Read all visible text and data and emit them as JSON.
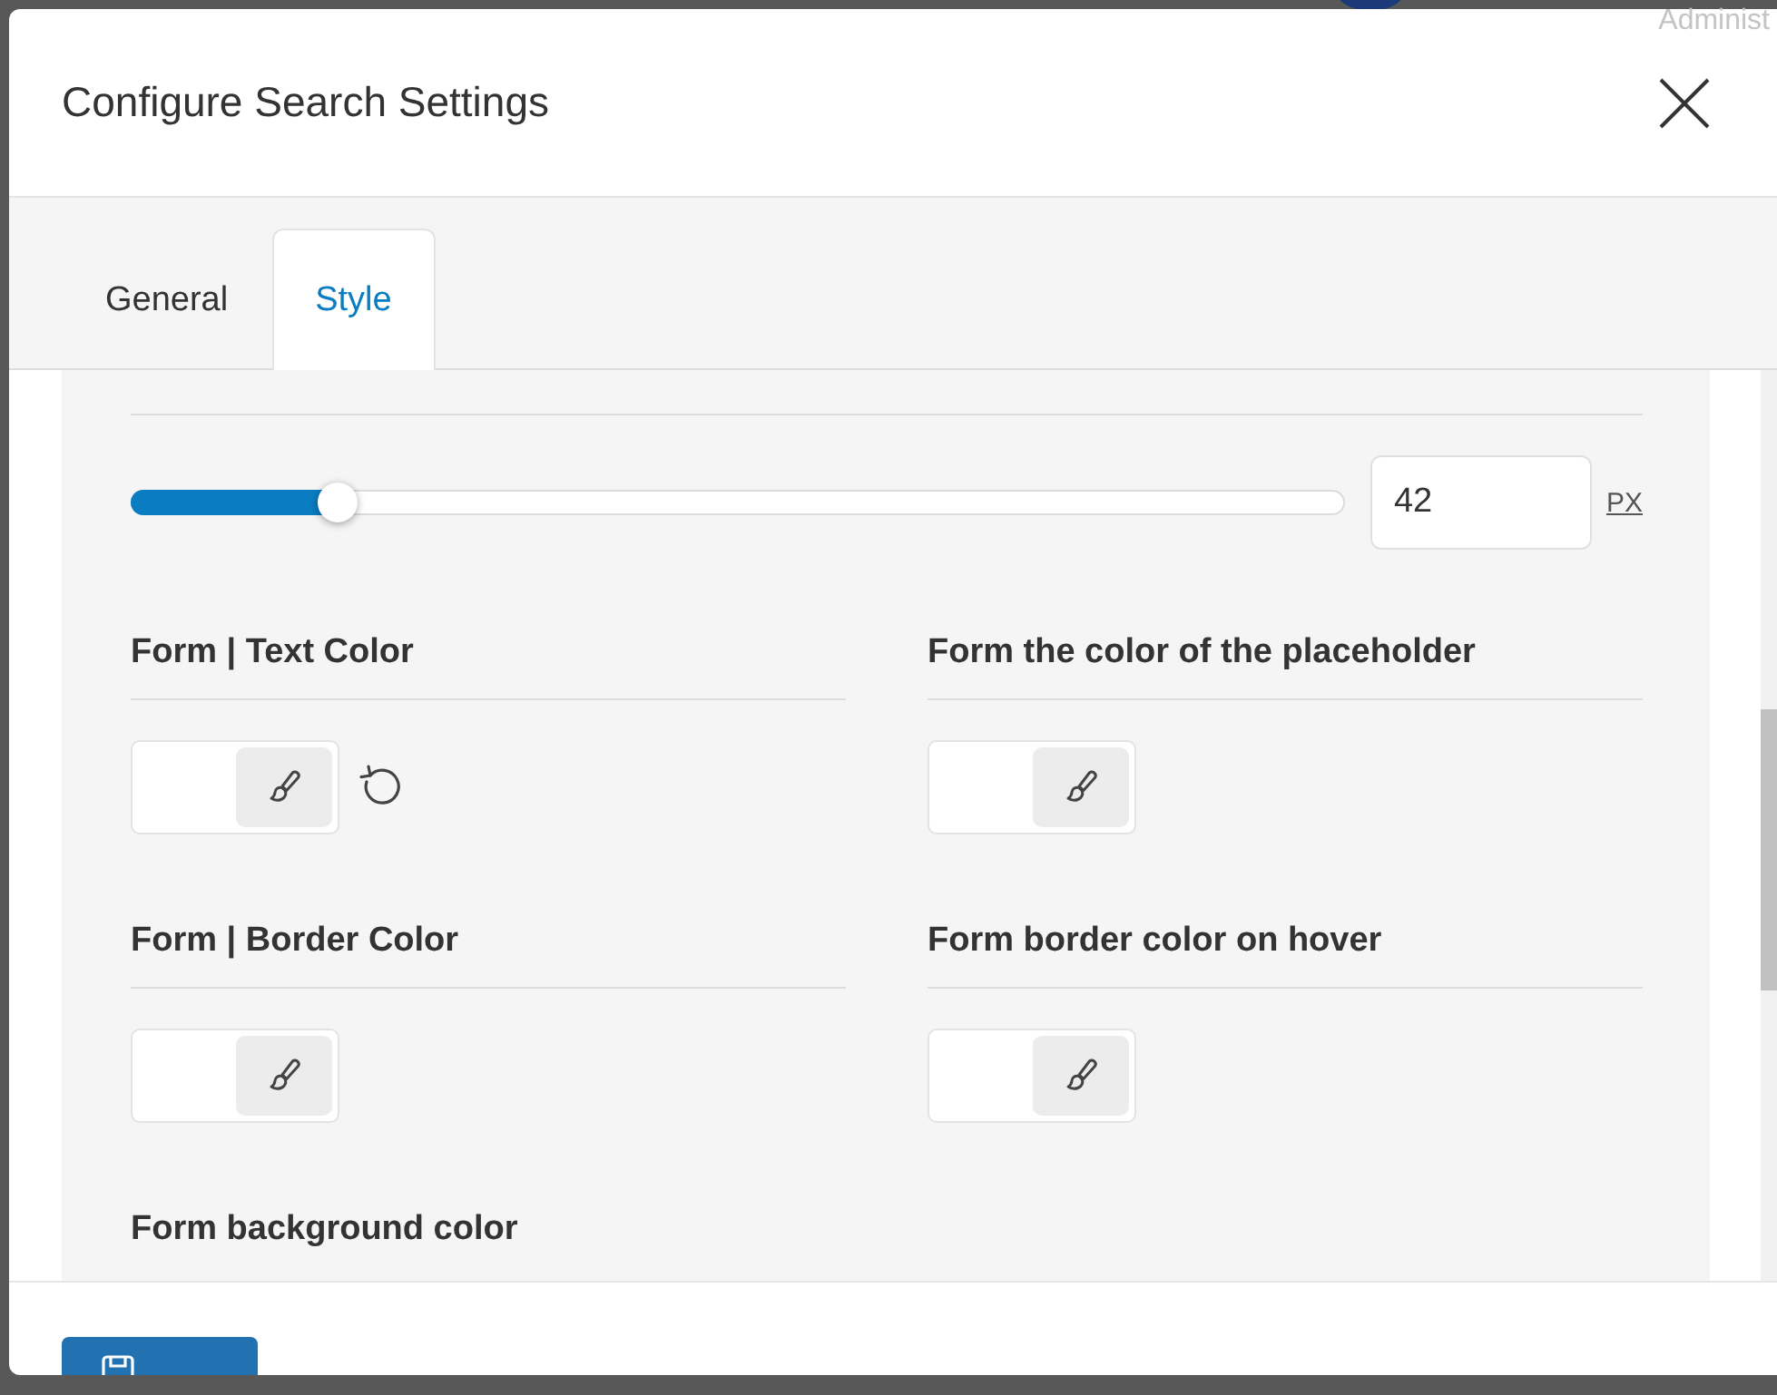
{
  "backdrop": {
    "user_label": "Administ"
  },
  "dialog": {
    "title": "Configure Search Settings"
  },
  "tabs": [
    {
      "label": "General",
      "selected": false
    },
    {
      "label": "Style",
      "selected": true
    }
  ],
  "height_setting": {
    "level": 0.17,
    "value": "42",
    "unit": "PX"
  },
  "color_settings": [
    {
      "label": "Form | Text Color",
      "resettable": true
    },
    {
      "label": "Form the color of the placeholder",
      "resettable": false
    },
    {
      "label": "Form | Border Color",
      "resettable": false
    },
    {
      "label": "Form border color on hover",
      "resettable": false
    }
  ],
  "next_section": {
    "label": "Form background color"
  }
}
